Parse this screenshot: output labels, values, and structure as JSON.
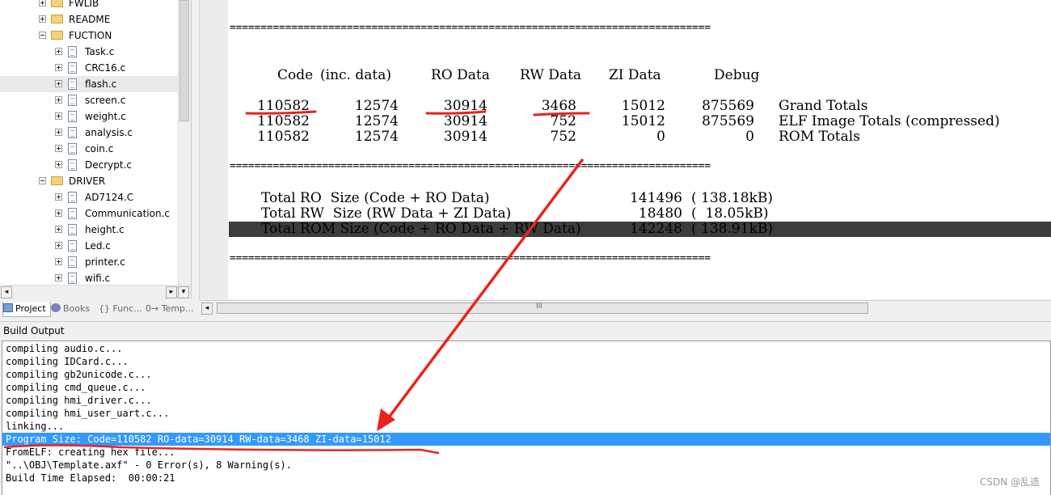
{
  "project_tree": {
    "items": [
      {
        "label": "FWLIB",
        "type": "folder",
        "expander": "plus",
        "level": 0
      },
      {
        "label": "README",
        "type": "folder",
        "expander": "plus",
        "level": 0
      },
      {
        "label": "FUCTION",
        "type": "folder",
        "expander": "minus",
        "level": 0
      },
      {
        "label": "Task.c",
        "type": "file",
        "expander": "plus",
        "level": 1
      },
      {
        "label": "CRC16.c",
        "type": "file",
        "expander": "plus",
        "level": 1
      },
      {
        "label": "flash.c",
        "type": "file",
        "expander": "plus",
        "level": 1,
        "selected": true
      },
      {
        "label": "screen.c",
        "type": "file",
        "expander": "plus",
        "level": 1
      },
      {
        "label": "weight.c",
        "type": "file",
        "expander": "plus",
        "level": 1
      },
      {
        "label": "analysis.c",
        "type": "file",
        "expander": "plus",
        "level": 1
      },
      {
        "label": "coin.c",
        "type": "file",
        "expander": "plus",
        "level": 1
      },
      {
        "label": "Decrypt.c",
        "type": "file",
        "expander": "plus",
        "level": 1
      },
      {
        "label": "DRIVER",
        "type": "folder",
        "expander": "minus",
        "level": 0
      },
      {
        "label": "AD7124.C",
        "type": "file",
        "expander": "plus",
        "level": 1
      },
      {
        "label": "Communication.c",
        "type": "file",
        "expander": "plus",
        "level": 1
      },
      {
        "label": "height.c",
        "type": "file",
        "expander": "plus",
        "level": 1
      },
      {
        "label": "Led.c",
        "type": "file",
        "expander": "plus",
        "level": 1
      },
      {
        "label": "printer.c",
        "type": "file",
        "expander": "plus",
        "level": 1
      },
      {
        "label": "wifi.c",
        "type": "file",
        "expander": "plus",
        "level": 1
      }
    ]
  },
  "panel_tabs": [
    {
      "label": "Project",
      "active": true,
      "icon": "project-icon"
    },
    {
      "label": "Books",
      "active": false,
      "icon": "books-icon"
    },
    {
      "label": "{} Func...",
      "active": false,
      "icon": "functions-icon"
    },
    {
      "label": "0→ Temp...",
      "active": false,
      "icon": "templates-icon"
    }
  ],
  "editor": {
    "separator": "==============================================================================",
    "columns": [
      "Code",
      "(inc. data)",
      "RO Data",
      "RW Data",
      "ZI Data",
      "Debug"
    ],
    "rows": [
      {
        "code": "110582",
        "inc": "12574",
        "ro": "30914",
        "rw": "3468",
        "zi": "15012",
        "debug": "875569",
        "label": "Grand Totals"
      },
      {
        "code": "110582",
        "inc": "12574",
        "ro": "30914",
        "rw": "752",
        "zi": "15012",
        "debug": "875569",
        "label": "ELF Image Totals (compressed)"
      },
      {
        "code": "110582",
        "inc": "12574",
        "ro": "30914",
        "rw": "752",
        "zi": "0",
        "debug": "0",
        "label": "ROM Totals"
      }
    ],
    "totals": [
      {
        "label": "Total RO  Size (Code + RO Data)",
        "value": "141496",
        "kb": "( 138.18kB)"
      },
      {
        "label": "Total RW  Size (RW Data + ZI Data)",
        "value": "18480",
        "kb": "(  18.05kB)"
      },
      {
        "label": "Total ROM Size (Code + RO Data + RW Data)",
        "value": "142248",
        "kb": "( 138.91kB)",
        "highlighted": true
      }
    ],
    "scroll_grip": "III"
  },
  "build_output": {
    "title": "Build Output",
    "lines": [
      {
        "text": "compiling audio.c..."
      },
      {
        "text": "compiling IDCard.c..."
      },
      {
        "text": "compiling gb2unicode.c..."
      },
      {
        "text": "compiling cmd_queue.c..."
      },
      {
        "text": "compiling hmi_driver.c..."
      },
      {
        "text": "compiling hmi_user_uart.c..."
      },
      {
        "text": "linking..."
      },
      {
        "text": "Program Size: Code=110582 RO-data=30914 RW-data=3468 ZI-data=15012",
        "highlighted": true
      },
      {
        "text": "FromELF: creating hex file..."
      },
      {
        "text": "\"..\\OBJ\\Template.axf\" - 0 Error(s), 8 Warning(s)."
      },
      {
        "text": "Build Time Elapsed:  00:00:21"
      }
    ]
  },
  "watermark": "CSDN @乱造",
  "colors": {
    "selection_blue": "#3399ff",
    "annotation_red": "#e8241c",
    "dark_highlight": "#3c3c3c"
  }
}
